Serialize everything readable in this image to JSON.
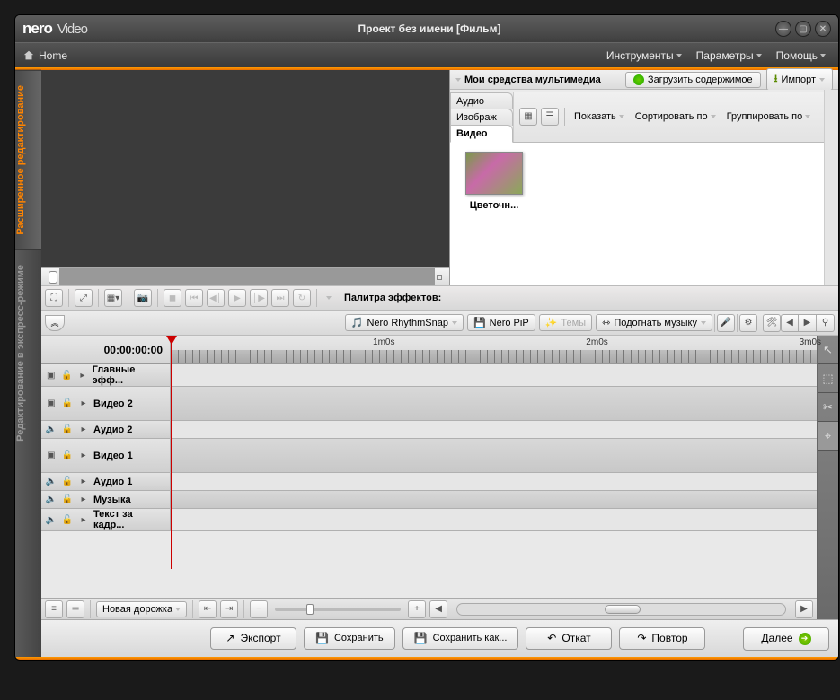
{
  "app": {
    "brand": "nero",
    "product": "Video",
    "title": "Проект без имени [Фильм]"
  },
  "menubar": {
    "home": "Home",
    "tools": "Инструменты",
    "options": "Параметры",
    "help": "Помощь"
  },
  "side_tabs": {
    "active": "Расширенное редактирование",
    "inactive": "Редактирование в экспресс-режиме"
  },
  "media": {
    "header": "Мои средства мультимедиа",
    "load_btn": "Загрузить содержимое",
    "import_btn": "Импорт",
    "tabs": {
      "audio": "Аудио",
      "image": "Изображ",
      "video": "Видео"
    },
    "toolbar": {
      "show": "Показать",
      "sort": "Сортировать по",
      "group": "Группировать по"
    },
    "items": [
      {
        "label": "Цветочн..."
      }
    ]
  },
  "effects": {
    "palette_label": "Палитра эффектов:"
  },
  "timeline_toolbar": {
    "rhythm": "Nero RhythmSnap",
    "pip": "Nero PiP",
    "themes": "Темы",
    "fit_music": "Подогнать музыку"
  },
  "timeline": {
    "timecode": "00:00:00:00",
    "marks": [
      "1m0s",
      "2m0s",
      "3m0s"
    ],
    "tracks": [
      {
        "label": "Главные эфф...",
        "tall": false,
        "type": "fx"
      },
      {
        "label": "Видео 2",
        "tall": true,
        "type": "video"
      },
      {
        "label": "Аудио 2",
        "tall": false,
        "type": "audio"
      },
      {
        "label": "Видео 1",
        "tall": true,
        "type": "video"
      },
      {
        "label": "Аудио 1",
        "tall": false,
        "type": "audio"
      },
      {
        "label": "Музыка",
        "tall": false,
        "type": "audio"
      },
      {
        "label": "Текст за кадр...",
        "tall": false,
        "type": "audio"
      }
    ],
    "new_track": "Новая дорожка"
  },
  "footer": {
    "export": "Экспорт",
    "save": "Сохранить",
    "save_as": "Сохранить как...",
    "undo": "Откат",
    "redo": "Повтор",
    "next": "Далее"
  }
}
